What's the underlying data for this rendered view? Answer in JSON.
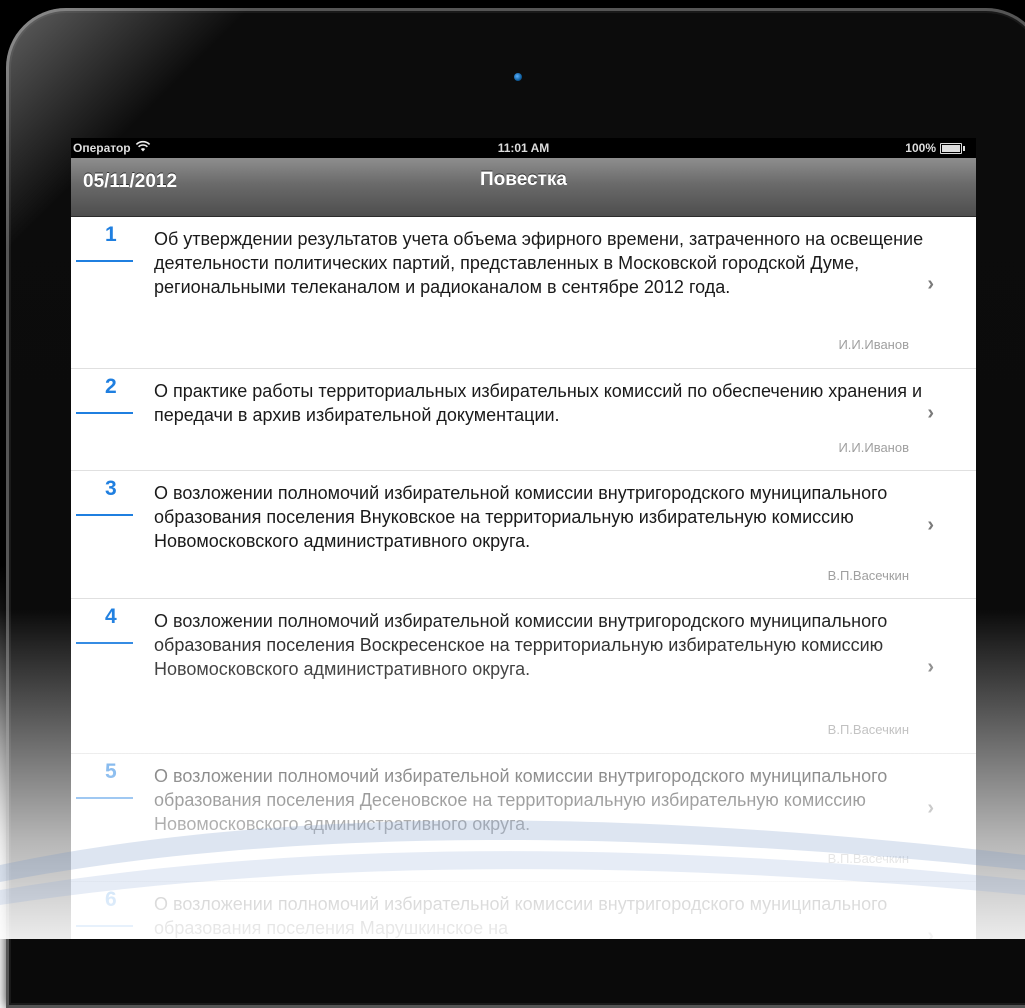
{
  "status_bar": {
    "carrier": "Оператор",
    "time": "11:01 AM",
    "battery": "100%"
  },
  "nav_bar": {
    "date": "05/11/2012",
    "title": "Повестка"
  },
  "agenda": [
    {
      "number": "1",
      "text": "Об утверждении результатов учета объема эфирного времени, затраченного на освещение деятельности политических партий, представленных в Московской городской Думе, региональными телеканалом и радиоканалом в сентябре 2012 года.",
      "author": "И.И.Иванов"
    },
    {
      "number": "2",
      "text": "О практике работы территориальных избирательных комиссий по обеспечению хранения и передачи в архив избирательной документации.",
      "author": "И.И.Иванов"
    },
    {
      "number": "3",
      "text": "О возложении полномочий избирательной комиссии внутригородского муниципального образования поселения Внуковское на территориальную избирательную комиссию Новомосковского административного округа.",
      "author": "В.П.Васечкин"
    },
    {
      "number": "4",
      "text": "О возложении полномочий избирательной комиссии внутригородского муниципального образования поселения Воскресенское на территориальную избирательную комиссию Новомосковского административного округа.",
      "author": "В.П.Васечкин"
    },
    {
      "number": "5",
      "text": "О возложении полномочий избирательной комиссии внутригородского муниципального образования поселения Десеновское на территориальную избирательную комиссию Новомосковского административного округа.",
      "author": "В.П.Васечкин"
    },
    {
      "number": "6",
      "text": "О возложении полномочий избирательной комиссии внутригородского муниципального образования поселения Марушкинское на",
      "author": ""
    }
  ],
  "icons": {
    "wifi": "wifi-icon",
    "battery": "battery-icon",
    "chevron": "chevron-right-icon",
    "camera": "camera-icon"
  }
}
